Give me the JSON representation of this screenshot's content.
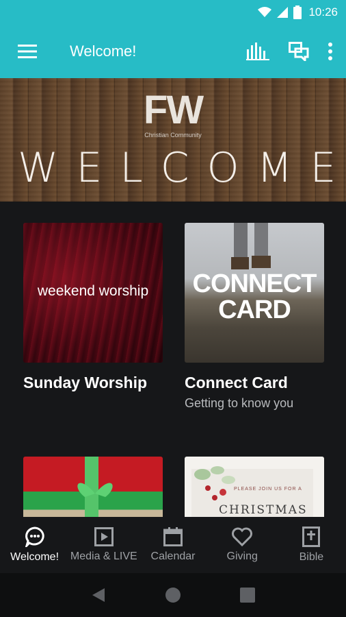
{
  "status_bar": {
    "time": "10:26"
  },
  "app_bar": {
    "title": "Welcome!"
  },
  "hero": {
    "logo": "FW",
    "logo_subtitle": "Christian Community",
    "welcome": "WELCOME"
  },
  "cards": [
    {
      "title": "Sunday Worship",
      "subtitle": "",
      "thumb_text": "weekend worship"
    },
    {
      "title": "Connect Card",
      "subtitle": "Getting to know you",
      "thumb_text_line1": "CONNECT",
      "thumb_text_line2": "CARD"
    },
    {
      "title": "",
      "subtitle": ""
    },
    {
      "title": "",
      "subtitle": "",
      "thumb_small": "PLEASE JOIN US FOR A",
      "thumb_big": "CHRISTMAS"
    }
  ],
  "bottom_nav": [
    {
      "label": "Welcome!",
      "icon": "chat-bubble-icon",
      "active": true
    },
    {
      "label": "Media & LIVE",
      "icon": "play-icon",
      "active": false
    },
    {
      "label": "Calendar",
      "icon": "calendar-icon",
      "active": false
    },
    {
      "label": "Giving",
      "icon": "heart-icon",
      "active": false
    },
    {
      "label": "Bible",
      "icon": "bible-icon",
      "active": false
    }
  ],
  "colors": {
    "accent": "#27bcc6",
    "background": "#161719",
    "inactive": "#9ea1a5"
  }
}
